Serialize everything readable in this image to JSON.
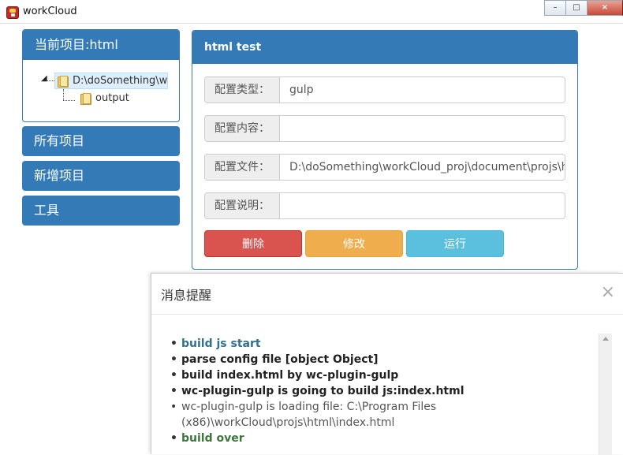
{
  "window": {
    "title": "workCloud",
    "controls": [
      "–",
      "□",
      "×"
    ]
  },
  "sidebar": {
    "project_title": "当前项目:html",
    "tree": {
      "root": "D:\\doSomething\\w",
      "child": "output"
    },
    "items": [
      {
        "label": "所有项目"
      },
      {
        "label": "新增项目"
      },
      {
        "label": "工具"
      }
    ]
  },
  "main": {
    "title": "html test",
    "fields": [
      {
        "label": "配置类型：",
        "value": "gulp"
      },
      {
        "label": "配置内容：",
        "value": ""
      },
      {
        "label": "配置文件：",
        "value": "D:\\doSomething\\workCloud_proj\\document\\projs\\html"
      },
      {
        "label": "配置说明：",
        "value": ""
      }
    ],
    "buttons": {
      "delete": "删除",
      "edit": "修改",
      "run": "运行"
    }
  },
  "dialog": {
    "title": "消息提醒",
    "close": "×",
    "messages": [
      "build js start",
      "parse config file [object Object]",
      "build index.html by wc-plugin-gulp",
      "wc-plugin-gulp is going to build js:index.html",
      "wc-plugin-gulp is loading file: C:\\Program Files (x86)\\workCloud\\projs\\html\\index.html",
      "build over"
    ]
  },
  "colors": {
    "primary": "#337ab7",
    "danger": "#d9534f",
    "warning": "#f0ad4e",
    "info": "#5bc0de"
  }
}
